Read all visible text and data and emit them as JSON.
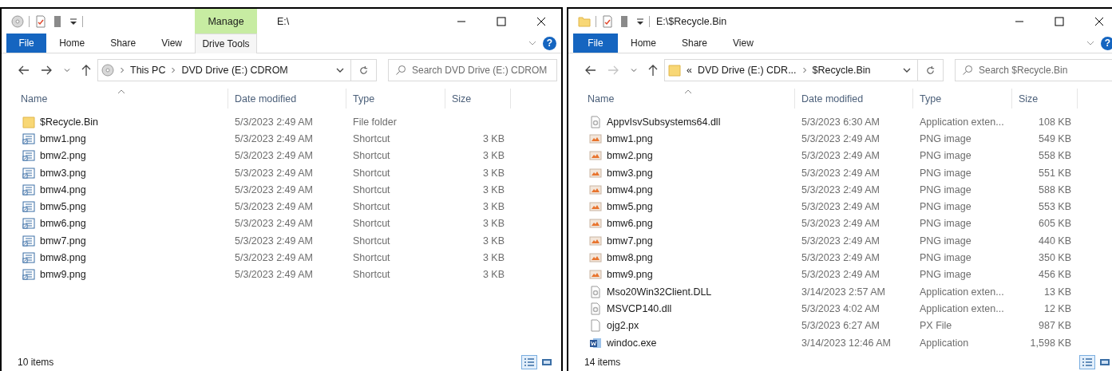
{
  "windows": [
    {
      "title": "E:\\",
      "drive_root": true,
      "context_tab": {
        "group": "Manage",
        "label": "Drive Tools"
      },
      "ribbon_tabs": [
        {
          "label": "File",
          "kind": "file"
        },
        {
          "label": "Home",
          "kind": "plain"
        },
        {
          "label": "Share",
          "kind": "plain"
        },
        {
          "label": "View",
          "kind": "plain"
        }
      ],
      "help": "?",
      "forward_disabled": false,
      "breadcrumbs": [
        "This PC",
        "DVD Drive (E:) CDROM"
      ],
      "search_placeholder": "Search DVD Drive (E:) CDROM",
      "columns": [
        {
          "label": "Name",
          "sorted": true
        },
        {
          "label": "Date modified",
          "sorted": false
        },
        {
          "label": "Type",
          "sorted": false
        },
        {
          "label": "Size",
          "sorted": false
        }
      ],
      "rows": [
        {
          "name": "$Recycle.Bin",
          "kind": "folder",
          "date": "5/3/2023 2:49 AM",
          "type": "File folder"
        },
        {
          "name": "bmw1.png",
          "kind": "shortcut",
          "date": "5/3/2023 2:49 AM",
          "type": "Shortcut",
          "size": "3 KB"
        },
        {
          "name": "bmw2.png",
          "kind": "shortcut",
          "date": "5/3/2023 2:49 AM",
          "type": "Shortcut",
          "size": "3 KB"
        },
        {
          "name": "bmw3.png",
          "kind": "shortcut",
          "date": "5/3/2023 2:49 AM",
          "type": "Shortcut",
          "size": "3 KB"
        },
        {
          "name": "bmw4.png",
          "kind": "shortcut",
          "date": "5/3/2023 2:49 AM",
          "type": "Shortcut",
          "size": "3 KB"
        },
        {
          "name": "bmw5.png",
          "kind": "shortcut",
          "date": "5/3/2023 2:49 AM",
          "type": "Shortcut",
          "size": "3 KB"
        },
        {
          "name": "bmw6.png",
          "kind": "shortcut",
          "date": "5/3/2023 2:49 AM",
          "type": "Shortcut",
          "size": "3 KB"
        },
        {
          "name": "bmw7.png",
          "kind": "shortcut",
          "date": "5/3/2023 2:49 AM",
          "type": "Shortcut",
          "size": "3 KB"
        },
        {
          "name": "bmw8.png",
          "kind": "shortcut",
          "date": "5/3/2023 2:49 AM",
          "type": "Shortcut",
          "size": "3 KB"
        },
        {
          "name": "bmw9.png",
          "kind": "shortcut",
          "date": "5/3/2023 2:49 AM",
          "type": "Shortcut",
          "size": "3 KB"
        }
      ],
      "status": "10 items",
      "view_buttons": [
        {
          "kind": "details",
          "selected": true
        },
        {
          "kind": "tiles",
          "selected": false
        }
      ]
    },
    {
      "title": "E:\\$Recycle.Bin",
      "drive_root": false,
      "ribbon_tabs": [
        {
          "label": "File",
          "kind": "file"
        },
        {
          "label": "Home",
          "kind": "plain"
        },
        {
          "label": "Share",
          "kind": "plain"
        },
        {
          "label": "View",
          "kind": "plain"
        }
      ],
      "help": "?",
      "forward_disabled": true,
      "breadcrumb_overflow": "«",
      "breadcrumbs": [
        "DVD Drive (E:) CDR...",
        "$Recycle.Bin"
      ],
      "search_placeholder": "Search $Recycle.Bin",
      "columns": [
        {
          "label": "Name",
          "sorted": true
        },
        {
          "label": "Date modified",
          "sorted": false
        },
        {
          "label": "Type",
          "sorted": false
        },
        {
          "label": "Size",
          "sorted": false
        }
      ],
      "rows": [
        {
          "name": "AppvIsvSubsystems64.dll",
          "kind": "dll",
          "date": "5/3/2023 6:30 AM",
          "type": "Application exten...",
          "size": "108 KB"
        },
        {
          "name": "bmw1.png",
          "kind": "image",
          "date": "5/3/2023 2:49 AM",
          "type": "PNG image",
          "size": "549 KB"
        },
        {
          "name": "bmw2.png",
          "kind": "image",
          "date": "5/3/2023 2:49 AM",
          "type": "PNG image",
          "size": "558 KB"
        },
        {
          "name": "bmw3.png",
          "kind": "image",
          "date": "5/3/2023 2:49 AM",
          "type": "PNG image",
          "size": "551 KB"
        },
        {
          "name": "bmw4.png",
          "kind": "image",
          "date": "5/3/2023 2:49 AM",
          "type": "PNG image",
          "size": "588 KB"
        },
        {
          "name": "bmw5.png",
          "kind": "image",
          "date": "5/3/2023 2:49 AM",
          "type": "PNG image",
          "size": "553 KB"
        },
        {
          "name": "bmw6.png",
          "kind": "image",
          "date": "5/3/2023 2:49 AM",
          "type": "PNG image",
          "size": "605 KB"
        },
        {
          "name": "bmw7.png",
          "kind": "image",
          "date": "5/3/2023 2:49 AM",
          "type": "PNG image",
          "size": "440 KB"
        },
        {
          "name": "bmw8.png",
          "kind": "image",
          "date": "5/3/2023 2:49 AM",
          "type": "PNG image",
          "size": "350 KB"
        },
        {
          "name": "bmw9.png",
          "kind": "image",
          "date": "5/3/2023 2:49 AM",
          "type": "PNG image",
          "size": "456 KB"
        },
        {
          "name": "Mso20Win32Client.DLL",
          "kind": "dll",
          "date": "3/14/2023 2:57 AM",
          "type": "Application exten...",
          "size": "13 KB"
        },
        {
          "name": "MSVCP140.dll",
          "kind": "dll",
          "date": "5/3/2023 4:02 AM",
          "type": "Application exten...",
          "size": "12 KB"
        },
        {
          "name": "ojg2.px",
          "kind": "file",
          "date": "5/3/2023 6:27 AM",
          "type": "PX File",
          "size": "987 KB"
        },
        {
          "name": "windoc.exe",
          "kind": "word",
          "date": "3/14/2023 12:46 AM",
          "type": "Application",
          "size": "1,598 KB"
        }
      ],
      "status": "14 items",
      "view_buttons": [
        {
          "kind": "details",
          "selected": true
        },
        {
          "kind": "tiles",
          "selected": false
        }
      ]
    }
  ]
}
